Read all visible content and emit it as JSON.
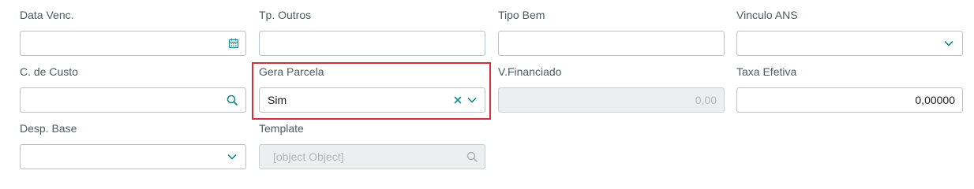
{
  "form": {
    "data_venc": {
      "label": "Data Venc.",
      "value": "",
      "icon": "calendar-icon"
    },
    "tp_outros": {
      "label": "Tp. Outros",
      "value": ""
    },
    "tipo_bem": {
      "label": "Tipo Bem",
      "value": ""
    },
    "vinculo_ans": {
      "label": "Vinculo ANS",
      "value": "",
      "icon": "chevron-down-icon"
    },
    "c_de_custo": {
      "label": "C. de Custo",
      "value": "",
      "icon": "search-icon"
    },
    "gera_parcela": {
      "label": "Gera Parcela",
      "value": "Sim",
      "icons": [
        "clear-icon",
        "chevron-down-icon"
      ]
    },
    "v_financiado": {
      "label": "V.Financiado",
      "value": "0,00",
      "disabled": true
    },
    "taxa_efetiva": {
      "label": "Taxa Efetiva",
      "value": "0,00000"
    },
    "desp_base": {
      "label": "Desp. Base",
      "value": "",
      "icon": "chevron-down-icon"
    },
    "template": {
      "label": "Template",
      "value": "[object Object]",
      "disabled": true,
      "icon": "search-icon"
    }
  },
  "colors": {
    "accent": "#1a8a8c",
    "highlight": "#d32f3a",
    "label": "#4a5c60",
    "disabled_bg": "#eceff0"
  }
}
